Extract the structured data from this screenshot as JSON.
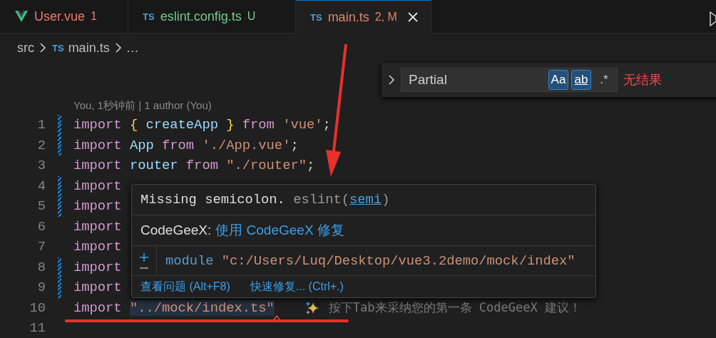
{
  "tabs": [
    {
      "kind": "vue",
      "label": "User.vue",
      "status": "1",
      "color": "#f0776a",
      "selected": false
    },
    {
      "kind": "ts",
      "badge": "TS",
      "label": "eslint.config.ts",
      "status": "U",
      "color": "#73c991",
      "selected": false
    },
    {
      "kind": "ts",
      "badge": "TS",
      "label": "main.ts",
      "status": "2, M",
      "color": "#e2836e",
      "selected": true
    }
  ],
  "breadcrumb": {
    "folder": "src",
    "badge": "TS",
    "file": "main.ts",
    "more": "…"
  },
  "find": {
    "value": "Partial",
    "toggles": [
      {
        "label": "Aa",
        "on": true
      },
      {
        "label": "ab",
        "on": true
      },
      {
        "label": ".*",
        "on": false
      }
    ],
    "result": "无结果"
  },
  "blame": "You, 1秒钟前 | 1 author (You)",
  "lines": [
    {
      "number": "1",
      "modified": true,
      "tokens": [
        {
          "kind": "keyword",
          "text": "import"
        },
        {
          "kind": "brace",
          "text": "{"
        },
        {
          "kind": "variable",
          "text": "createApp"
        },
        {
          "kind": "brace",
          "text": "}"
        },
        {
          "kind": "keyword",
          "text": "from"
        },
        {
          "kind": "string",
          "text": "'vue'"
        },
        {
          "kind": "punct",
          "text": ";"
        }
      ]
    },
    {
      "number": "2",
      "modified": true,
      "tokens": [
        {
          "kind": "keyword",
          "text": "import"
        },
        {
          "kind": "variable",
          "text": "App"
        },
        {
          "kind": "keyword",
          "text": "from"
        },
        {
          "kind": "string",
          "text": "'./App.vue'"
        },
        {
          "kind": "punct",
          "text": ";"
        }
      ]
    },
    {
      "number": "3",
      "modified": false,
      "tokens": [
        {
          "kind": "keyword",
          "text": "import"
        },
        {
          "kind": "variable",
          "text": "router"
        },
        {
          "kind": "keyword",
          "text": "from"
        },
        {
          "kind": "string",
          "text": "\"./router\""
        },
        {
          "kind": "punct",
          "text": ";"
        }
      ]
    },
    {
      "number": "4",
      "modified": true,
      "tokens": [
        {
          "kind": "keyword",
          "text": "import"
        }
      ]
    },
    {
      "number": "5",
      "modified": true,
      "tokens": [
        {
          "kind": "keyword",
          "text": "import"
        }
      ]
    },
    {
      "number": "6",
      "modified": false,
      "tokens": [
        {
          "kind": "keyword",
          "text": "import"
        }
      ]
    },
    {
      "number": "7",
      "modified": false,
      "tokens": [
        {
          "kind": "keyword",
          "text": "import"
        }
      ]
    },
    {
      "number": "8",
      "modified": true,
      "tokens": [
        {
          "kind": "keyword",
          "text": "import"
        }
      ]
    },
    {
      "number": "9",
      "modified": true,
      "tokens": [
        {
          "kind": "keyword",
          "text": "import"
        }
      ]
    },
    {
      "number": "10",
      "modified": false,
      "error": true,
      "tokens": [
        {
          "kind": "keyword",
          "text": "import"
        },
        {
          "kind": "string",
          "text": "\"../mock/index.ts\""
        }
      ],
      "hint": "按下Tab来采纳您的第一条 CodeGeeX 建议！"
    },
    {
      "number": "11",
      "modified": false
    }
  ],
  "hover": {
    "message": "Missing semicolon.",
    "source": "eslint(",
    "code": "semi",
    "source_end": ")",
    "fix_label": "CodeGeeX:",
    "fix_link": "使用 CodeGeeX 修复",
    "module_keyword": "module",
    "module_path": "\"c:/Users/Luq/Desktop/vue3.2demo/mock/index\"",
    "actions": [
      "查看问题 (Alt+F8)",
      "快速修复... (Ctrl+.)"
    ]
  }
}
